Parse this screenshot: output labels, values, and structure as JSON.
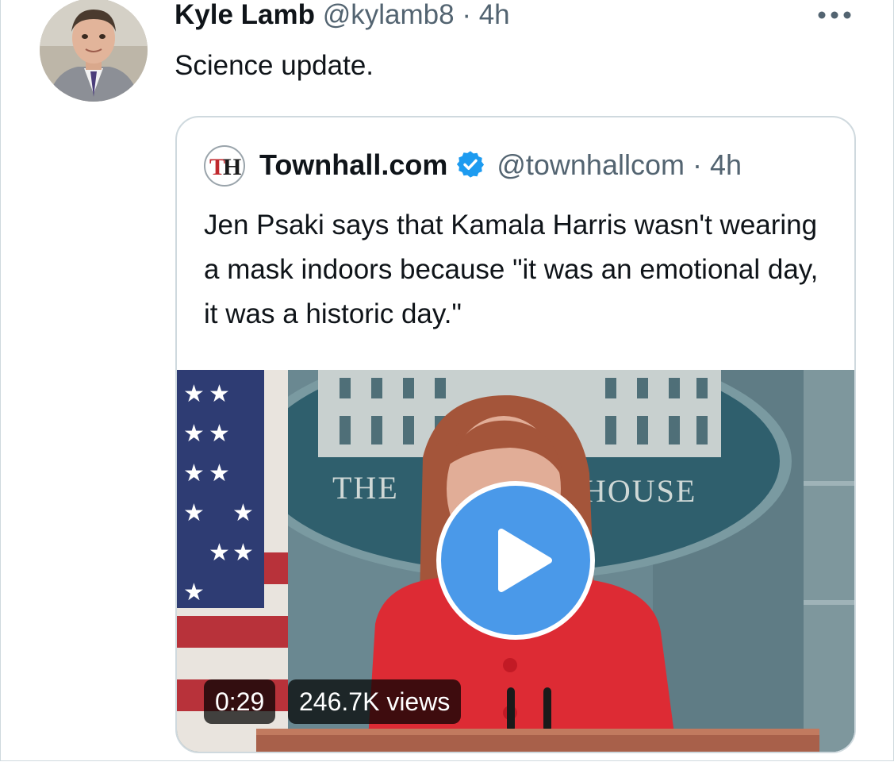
{
  "tweet": {
    "author_name": "Kyle Lamb",
    "author_handle": "@kylamb8",
    "separator": "·",
    "time": "4h",
    "text": "Science update."
  },
  "quote": {
    "logo_text": "TH",
    "author_name": "Townhall.com",
    "author_handle": "@townhallcom",
    "separator": "·",
    "time": "4h",
    "verified": true,
    "text": "Jen Psaki says that Kamala Harris wasn't wearing a mask indoors because \"it was an emotional day, it was a historic day.\"",
    "video": {
      "backdrop_text_left": "THE",
      "backdrop_text_right": "HOUSE",
      "duration": "0:29",
      "views": "246.7K views"
    }
  },
  "icons": {
    "more": "more-horizontal-icon",
    "verified": "verified-badge-icon",
    "play": "play-icon"
  },
  "colors": {
    "accent_blue": "#1d9bf0",
    "play_button": "#4a99e9",
    "secondary_text": "#536471",
    "border": "#cfd9de"
  }
}
